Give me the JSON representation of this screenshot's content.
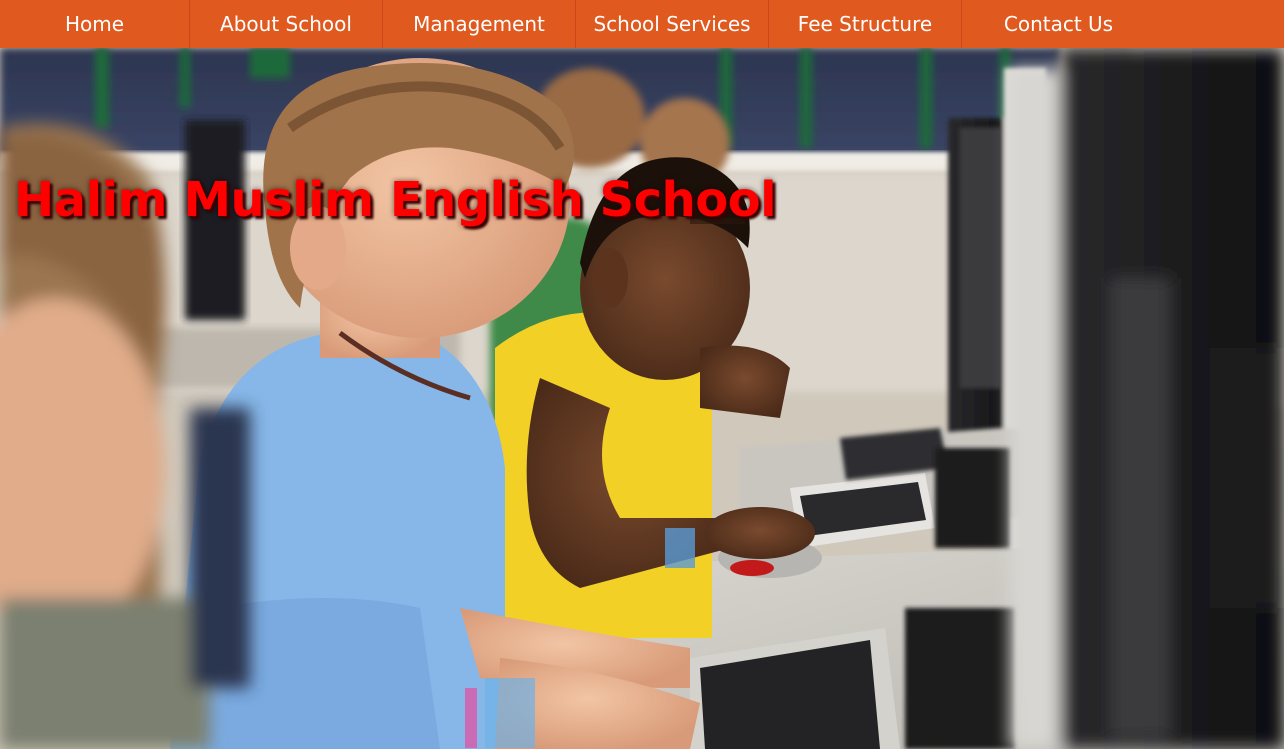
{
  "nav": {
    "items": [
      {
        "label": "Home"
      },
      {
        "label": "About School"
      },
      {
        "label": "Management"
      },
      {
        "label": "School Services"
      },
      {
        "label": "Fee Structure"
      },
      {
        "label": "Contact Us"
      }
    ]
  },
  "hero": {
    "title": "Halim Muslim English School",
    "image_description_icon": "children-at-computers-photo"
  },
  "colors": {
    "nav_background": "#e05a20",
    "nav_text": "#ffffff",
    "title_text": "#ff0000"
  }
}
